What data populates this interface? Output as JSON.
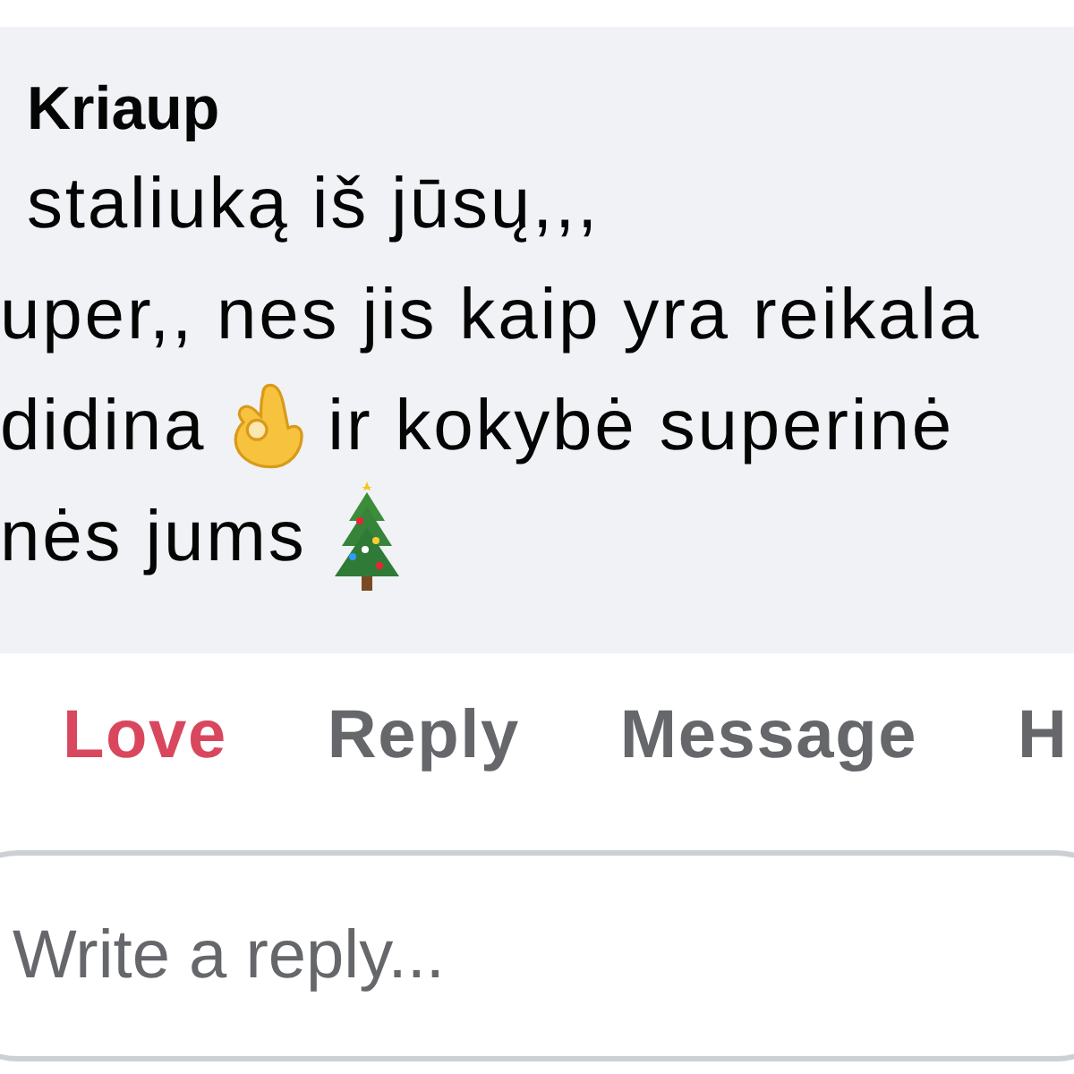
{
  "comment": {
    "author": "Kriaup",
    "lines": [
      [
        {
          "kind": "text",
          "text": "staliuką iš jūsų,,,"
        }
      ],
      [
        {
          "kind": "text",
          "text": "uper,, nes jis kaip yra reikala"
        }
      ],
      [
        {
          "kind": "text",
          "text": "didina"
        },
        {
          "kind": "ok_hand"
        },
        {
          "kind": "text",
          "text": "ir kokybė superinė"
        }
      ],
      [
        {
          "kind": "text",
          "text": "nės jums"
        },
        {
          "kind": "tree"
        }
      ]
    ]
  },
  "actions": [
    {
      "label": "Love",
      "selected": true
    },
    {
      "label": "Reply",
      "selected": false
    },
    {
      "label": "Message",
      "selected": false
    },
    {
      "label": "H",
      "selected": false
    }
  ],
  "reply_field": {
    "placeholder": "Write a reply..."
  }
}
